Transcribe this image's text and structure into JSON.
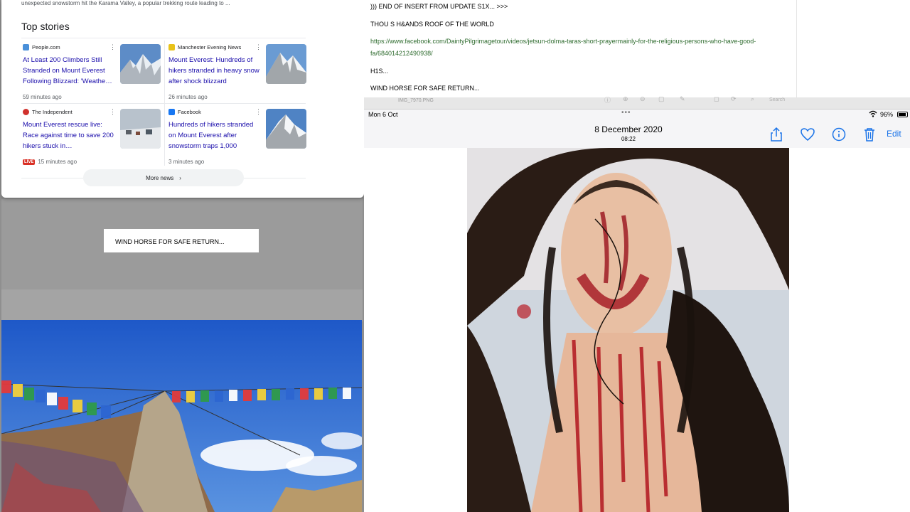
{
  "news": {
    "snippet": "unexpected snowstorm hit the Karama Valley, a popular trekking route leading to ...",
    "section_title": "Top stories",
    "stories": [
      {
        "source": "People.com",
        "source_color": "#4a90d9",
        "headline": "At Least 200 Climbers Still Stranded on Mount Everest Following Blizzard: 'Weathe…",
        "time": "59 minutes ago",
        "live": false
      },
      {
        "source": "Manchester Evening News",
        "source_color": "#e8c21a",
        "headline": "Mount Everest: Hundreds of hikers stranded in heavy snow after shock blizzard",
        "time": "26 minutes ago",
        "live": false
      },
      {
        "source": "The Independent",
        "source_color": "#d0312d",
        "headline": "Mount Everest rescue live: Race against time to save 200 hikers stuck in…",
        "time": "15 minutes ago",
        "live": true,
        "live_label": "LIVE"
      },
      {
        "source": "Facebook",
        "source_color": "#1877f2",
        "headline": "Hundreds of hikers stranded on Mount Everest after snowstorm traps 1,000",
        "time": "3 minutes ago",
        "live": false
      }
    ],
    "more_label": "More news"
  },
  "left_box": {
    "text": "WIND HORSE FOR SAFE RETURN..."
  },
  "doc": {
    "line1": "))) END OF INSERT FROM UPDATE S1X... >>>",
    "line2": "THOU S H&ANDS ROOF OF THE WORLD",
    "link": "https://www.facebook.com/DaintyPilgrimagetour/videos/jetsun-dolma-taras-short-prayermainly-for-the-religious-persons-who-have-good-fa/684014212490938/",
    "line3": "H1S...",
    "line4": "WIND HORSE FOR SAFE RETURN..."
  },
  "toolbar": {
    "file_name": "IMG_7970.PNG",
    "search_placeholder": "Search"
  },
  "status_bar": {
    "date": "Mon 6 Oct",
    "battery": "96%"
  },
  "photo_viewer": {
    "date": "8 December 2020",
    "time": "08:22",
    "edit_label": "Edit",
    "accent": "#1a73e8"
  }
}
